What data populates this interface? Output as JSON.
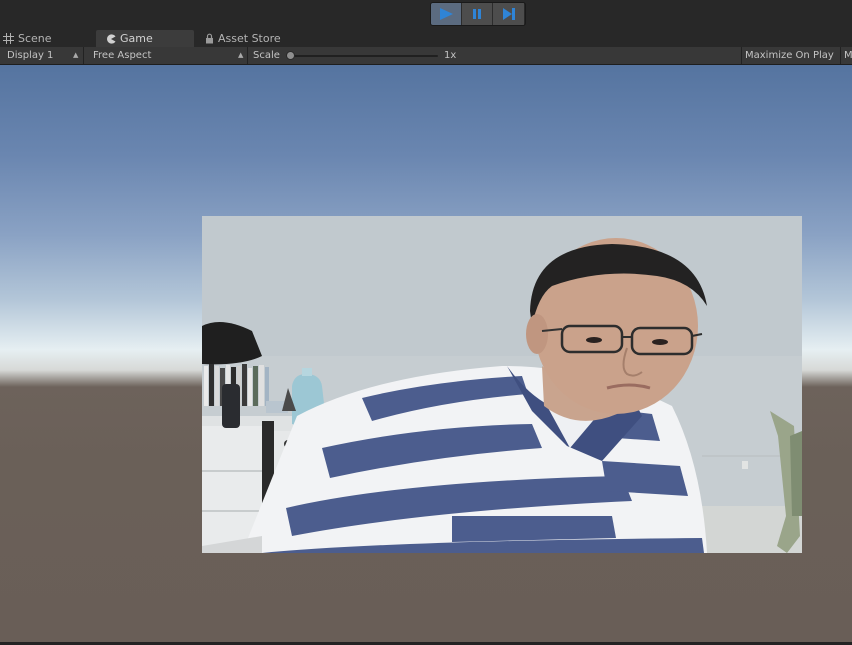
{
  "toolbar": {
    "play_label": "Play",
    "pause_label": "Pause",
    "step_label": "Step",
    "accent_color": "#2f84d6"
  },
  "tabs": [
    {
      "label": "Scene",
      "icon": "grid-icon",
      "selected": false
    },
    {
      "label": "Game",
      "icon": "pacman-icon",
      "selected": true
    },
    {
      "label": "Asset Store",
      "icon": "lock-icon",
      "selected": false
    }
  ],
  "game_controls": {
    "display": "Display 1",
    "aspect": "Free Aspect",
    "scale_label": "Scale",
    "scale_value": "1x",
    "maximize": "Maximize On Play",
    "overflow_text": "M"
  },
  "viewport": {
    "content": "webcam feed of a person in a striped shirt"
  }
}
